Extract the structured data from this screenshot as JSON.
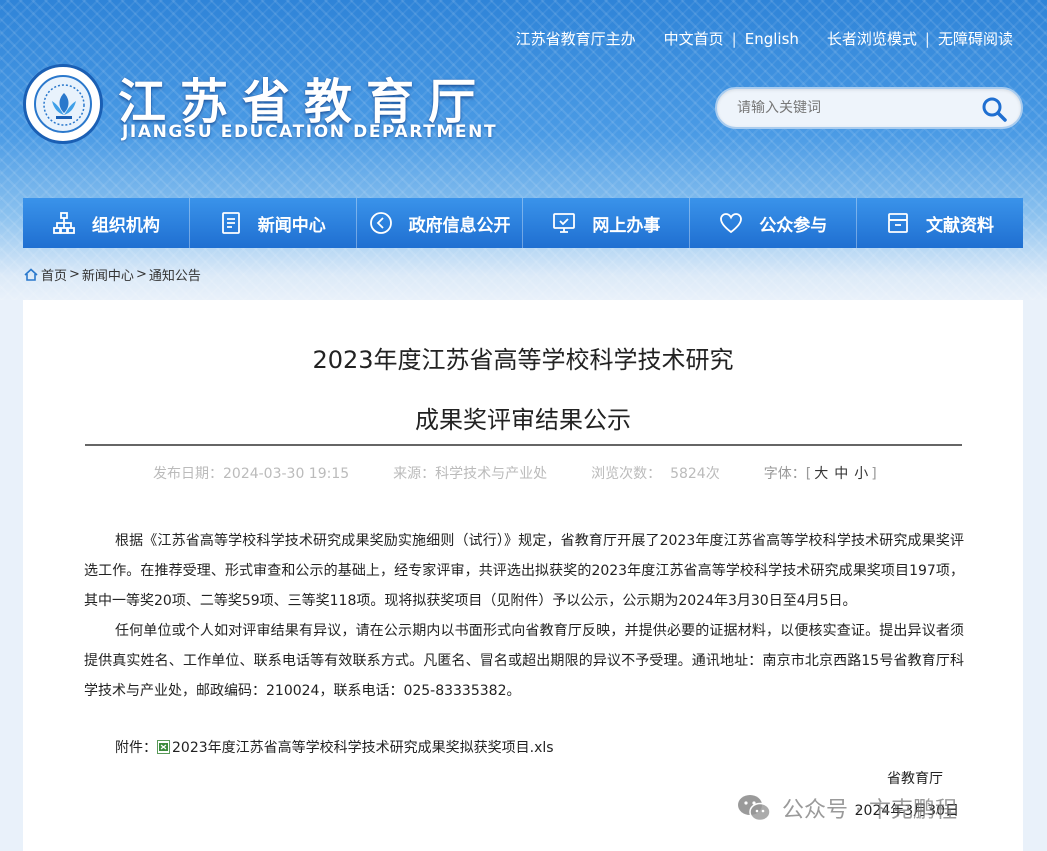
{
  "header": {
    "top_links": [
      "江苏省教育厅主办",
      "中文首页",
      "English",
      "长者浏览模式",
      "无障碍阅读"
    ],
    "site_name_cn": "江苏省教育厅",
    "site_name_en": "JIANGSU EDUCATION DEPARTMENT",
    "search_placeholder": "请输入关键词"
  },
  "nav": [
    {
      "label": "组织机构",
      "icon": "org-chart-icon"
    },
    {
      "label": "新闻中心",
      "icon": "document-icon"
    },
    {
      "label": "政府信息公开",
      "icon": "announce-icon"
    },
    {
      "label": "网上办事",
      "icon": "monitor-icon"
    },
    {
      "label": "公众参与",
      "icon": "heart-icon"
    },
    {
      "label": "文献资料",
      "icon": "archive-icon"
    }
  ],
  "breadcrumb": [
    "首页",
    "新闻中心",
    "通知公告"
  ],
  "article": {
    "title_line1": "2023年度江苏省高等学校科学技术研究",
    "title_line2": "成果奖评审结果公示",
    "publish_date": "发布日期：2024-03-30 19:15",
    "source": "来源：科学技术与产业处",
    "views_label": "浏览次数：",
    "views": "5824次",
    "fontsize_label": "字体：",
    "fontsize_options": [
      "大",
      "中",
      "小"
    ],
    "paragraph1": "根据《江苏省高等学校科学技术研究成果奖励实施细则（试行）》规定，省教育厅开展了2023年度江苏省高等学校科学技术研究成果奖评选工作。在推荐受理、形式审查和公示的基础上，经专家评审，共评选出拟获奖的2023年度江苏省高等学校科学技术研究成果奖项目197项，其中一等奖20项、二等奖59项、三等奖118项。现将拟获奖项目（见附件）予以公示，公示期为2024年3月30日至4月5日。",
    "paragraph2": "任何单位或个人如对评审结果有异议，请在公示期内以书面形式向省教育厅反映，并提供必要的证据材料，以便核实查证。提出异议者须提供真实姓名、工作单位、联系电话等有效联系方式。凡匿名、冒名或超出期限的异议不予受理。通讯地址：南京市北京西路15号省教育厅科学技术与产业处，邮政编码：210024，联系电话：025-83335382。",
    "attachment_label": "附件：",
    "attachment_file": "2023年度江苏省高等学校科学技术研究成果奖拟获奖项目.xls",
    "signature": "省教育厅",
    "sign_date": "2024年3月30日"
  },
  "watermark": "公众号 · 卞克鹏程"
}
